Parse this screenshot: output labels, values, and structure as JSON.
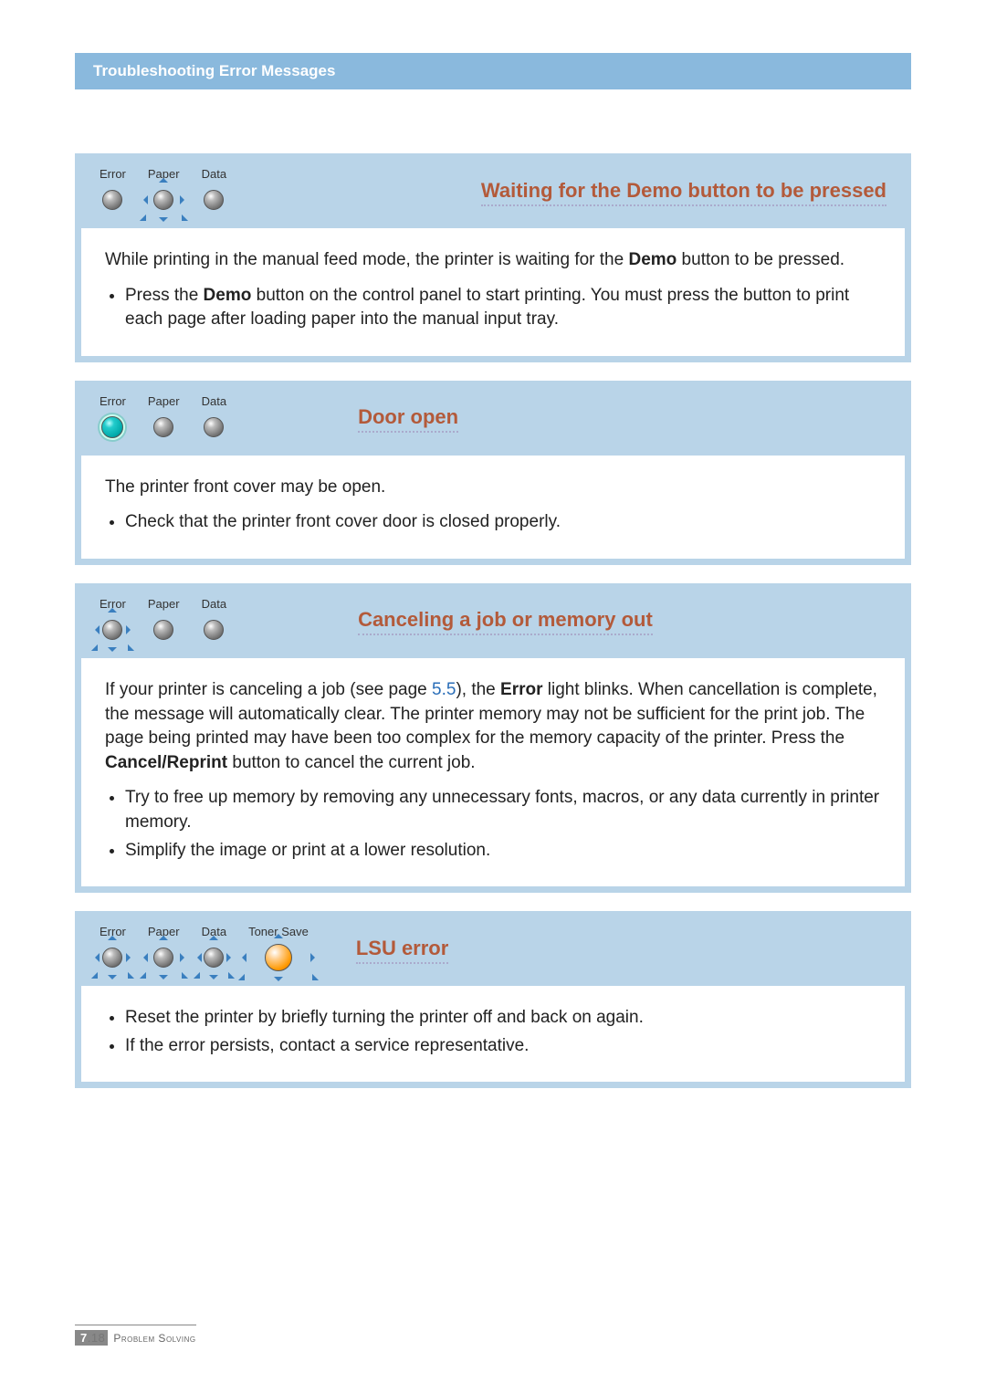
{
  "header": {
    "title": "Troubleshooting Error Messages"
  },
  "led_labels": {
    "error": "Error",
    "paper": "Paper",
    "data": "Data",
    "toner_save": "Toner Save"
  },
  "sections": [
    {
      "title": "Waiting for the Demo button to be pressed",
      "leds": {
        "error": "off",
        "paper": "blink",
        "data": "off"
      },
      "body_pre": "While printing in the manual feed mode, the printer is waiting for the ",
      "body_bold1": "Demo",
      "body_post": " button to be pressed.",
      "bullets_pre": "Press the ",
      "bullets_bold": "Demo",
      "bullets_post": " button on the control panel to start printing. You must press the button to print each page after loading paper into the manual input tray."
    },
    {
      "title": "Door open",
      "leds": {
        "error": "on",
        "paper": "off",
        "data": "off"
      },
      "body": "The printer front cover may be open.",
      "bullet1": "Check that the printer front cover door is closed properly."
    },
    {
      "title": "Canceling a job or memory out",
      "leds": {
        "error": "blink",
        "paper": "off",
        "data": "off"
      },
      "body_pre": "If your printer is canceling a job (see page ",
      "body_link": "5.5",
      "body_mid1": "), the ",
      "body_bold1": "Error",
      "body_mid2": " light blinks. When cancellation is complete, the message will automatically clear. The printer memory may not be sufficient for the print job. The page being printed may have been too complex for the memory capacity of the printer. Press the ",
      "body_bold2": "Cancel/Reprint",
      "body_post": " button to cancel the current job.",
      "bullet1": "Try to free up memory by removing any unnecessary fonts, macros, or any data currently in printer memory.",
      "bullet2": "Simplify the image or print at a lower resolution."
    },
    {
      "title": "LSU error",
      "leds": {
        "error": "blink",
        "paper": "blink",
        "data": "blink",
        "toner_save": "blink"
      },
      "bullet1": "Reset the printer by briefly turning the printer off and back on again.",
      "bullet2": "If the error persists, contact a service representative."
    }
  ],
  "footer": {
    "chapter": "7",
    "page": ".18",
    "label": "Problem Solving"
  }
}
